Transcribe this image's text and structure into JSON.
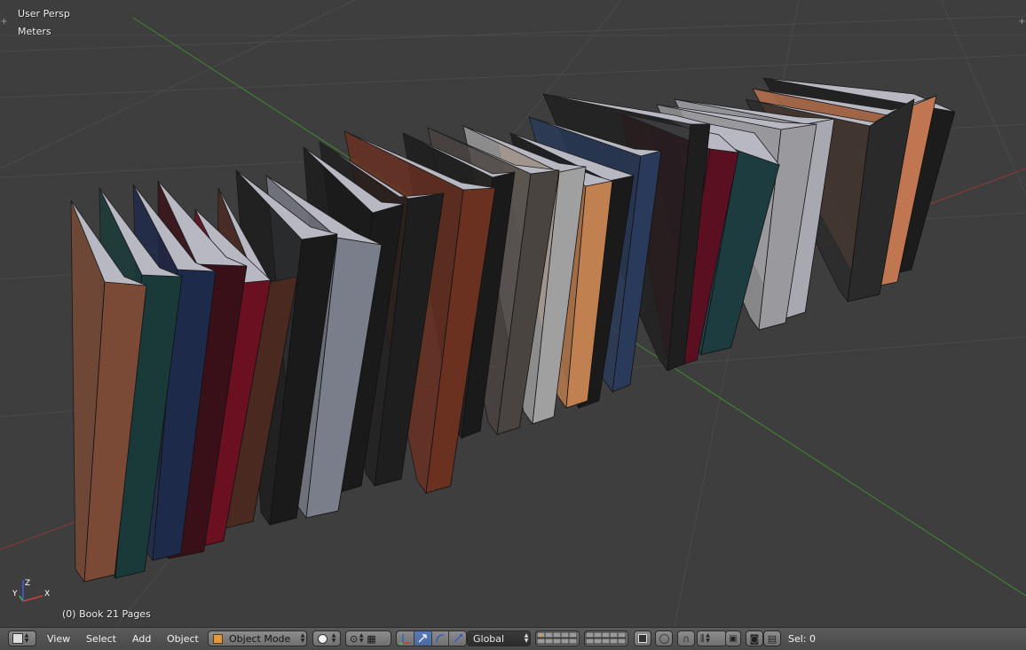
{
  "viewport": {
    "view_name": "User Persp",
    "units": "Meters",
    "selected_object": "(0) Book 21 Pages",
    "axis_labels": {
      "x": "X",
      "y": "Y",
      "z": "Z"
    }
  },
  "header": {
    "menus": {
      "view": "View",
      "select": "Select",
      "add": "Add",
      "object": "Object"
    },
    "mode": "Object Mode",
    "orientation": "Global",
    "selection_count": "Sel: 0"
  },
  "colors": {
    "background": "#3e3e3e",
    "grid": "#4a4a4a",
    "x_axis": "#8a3a3a",
    "y_axis": "#3f8a2f",
    "header": "#555555"
  }
}
